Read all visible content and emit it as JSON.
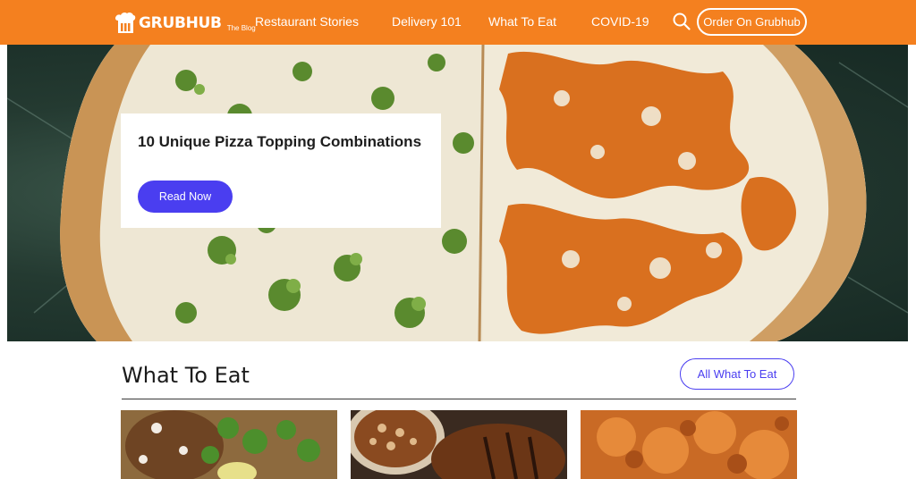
{
  "header": {
    "logo_text": "GRUBHUB",
    "logo_sub": "The Blog",
    "nav": [
      {
        "label": "Restaurant Stories"
      },
      {
        "label": "Delivery 101"
      },
      {
        "label": "What To Eat"
      },
      {
        "label": "COVID-19"
      }
    ],
    "search_icon": "search-icon",
    "order_label": "Order On Grubhub"
  },
  "hero": {
    "title": "10 Unique Pizza Topping Combinations",
    "button_label": "Read Now"
  },
  "section": {
    "title": "What To Eat",
    "all_label": "All What To Eat"
  },
  "colors": {
    "brand_orange": "#f4801f",
    "accent_purple": "#4a3ef0"
  }
}
